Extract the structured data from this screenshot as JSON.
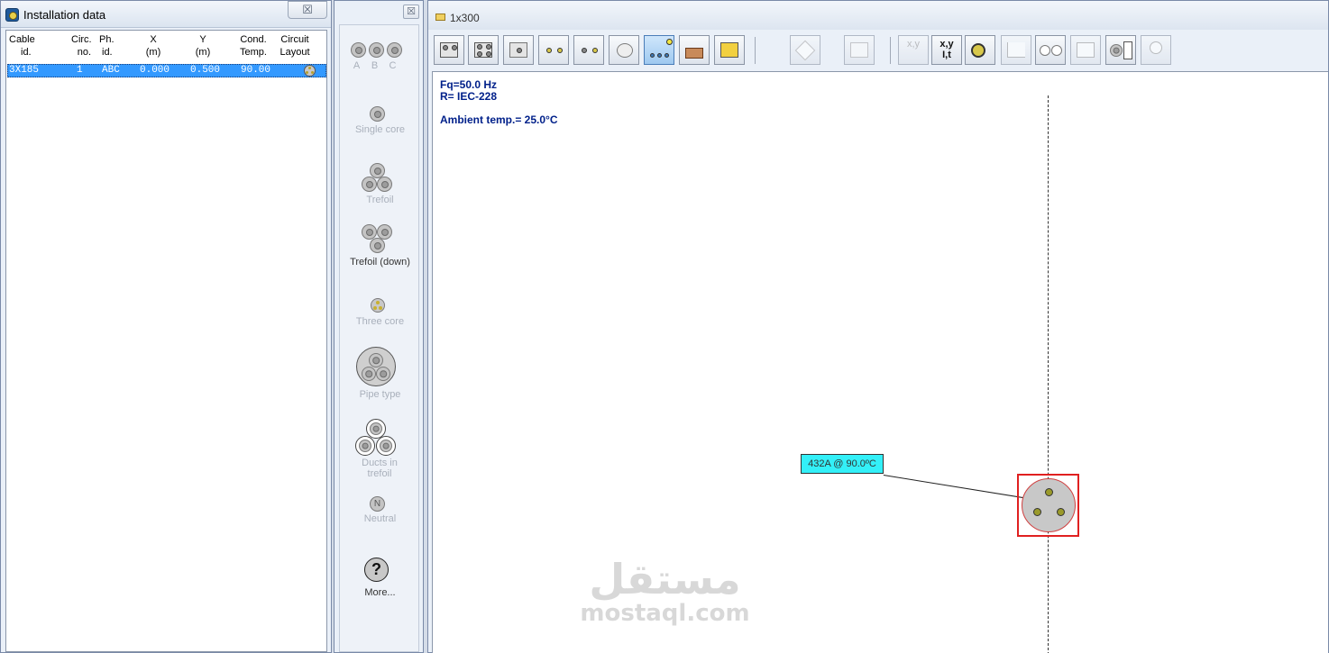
{
  "left_panel": {
    "title": "Installation data",
    "close_glyph": "☒",
    "columns": [
      {
        "line1": "Cable",
        "line2": "id."
      },
      {
        "line1": "Circ.",
        "line2": "no."
      },
      {
        "line1": "Ph.",
        "line2": "id."
      },
      {
        "line1": "X",
        "line2": "(m)"
      },
      {
        "line1": "Y",
        "line2": "(m)"
      },
      {
        "line1": "Cond.",
        "line2": "Temp."
      },
      {
        "line1": "Circuit",
        "line2": "Layout"
      }
    ],
    "rows": [
      {
        "cable_id": "3X185",
        "circ_no": "1",
        "ph_id": "ABC",
        "x": "0.000",
        "y": "0.500",
        "cond_temp": "90.00",
        "layout_icon": "three-core-icon"
      }
    ]
  },
  "palette": {
    "close_glyph": "☒",
    "abc_labels": [
      "A",
      "B",
      "C"
    ],
    "items": [
      {
        "label": "Single core",
        "icon": "single-core-icon"
      },
      {
        "label": "Trefoil",
        "icon": "trefoil-icon"
      },
      {
        "label": "Trefoil (down)",
        "icon": "trefoil-down-icon"
      },
      {
        "label": "Three core",
        "icon": "three-core-icon"
      },
      {
        "label": "Pipe type",
        "icon": "pipe-type-icon"
      },
      {
        "label": "Ducts in trefoil",
        "icon": "ducts-trefoil-icon"
      },
      {
        "label": "Neutral",
        "icon": "neutral-icon",
        "glyph": "N"
      },
      {
        "label": "More...",
        "icon": "help-icon",
        "glyph": "?"
      }
    ]
  },
  "drawing_window": {
    "title": "1x300",
    "toolbar_texts": {
      "xy": "x,y",
      "xylt": "x,y\nI,t"
    },
    "info": {
      "frequency": "Fq=50.0 Hz",
      "resistance": "R= IEC-228",
      "ambient": "Ambient temp.= 25.0°C"
    },
    "cable_label": "432A @ 90.0ºC"
  },
  "watermark": {
    "arabic": "مستقل",
    "latin": "mostaql.com"
  },
  "colors": {
    "selection": "#3399ff",
    "info_text": "#00208a",
    "label_bg": "#33f0f8",
    "select_box": "#e02020"
  }
}
